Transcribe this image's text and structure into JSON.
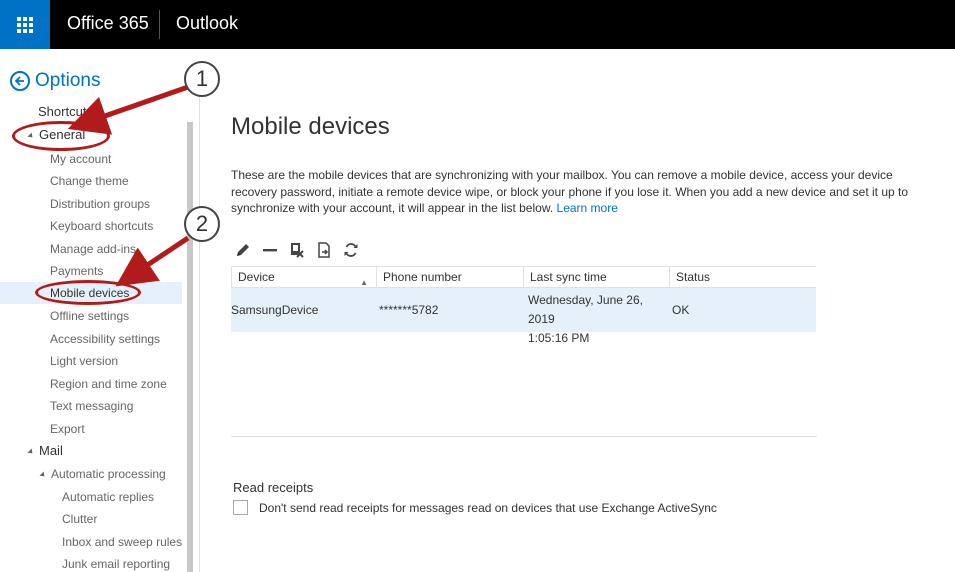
{
  "topbar": {
    "suite_name": "Office 365",
    "app_name": "Outlook",
    "accent_color": "#0072c6"
  },
  "nav": {
    "title": "Options",
    "items": [
      {
        "label": "Shortcuts",
        "type": "header"
      },
      {
        "label": "General",
        "type": "section"
      },
      {
        "label": "My account"
      },
      {
        "label": "Change theme"
      },
      {
        "label": "Distribution groups"
      },
      {
        "label": "Keyboard shortcuts"
      },
      {
        "label": "Manage add-ins"
      },
      {
        "label": "Payments"
      },
      {
        "label": "Mobile devices",
        "selected": true
      },
      {
        "label": "Offline settings"
      },
      {
        "label": "Accessibility settings"
      },
      {
        "label": "Light version"
      },
      {
        "label": "Region and time zone"
      },
      {
        "label": "Text messaging"
      },
      {
        "label": "Export"
      },
      {
        "label": "Mail",
        "type": "section"
      },
      {
        "label": "Automatic processing",
        "type": "subsection"
      },
      {
        "label": "Automatic replies"
      },
      {
        "label": "Clutter"
      },
      {
        "label": "Inbox and sweep rules"
      },
      {
        "label": "Junk email reporting"
      }
    ]
  },
  "main": {
    "title": "Mobile devices",
    "intro": "These are the mobile devices that are synchronizing with your mailbox. You can remove a mobile device, access your device recovery password, initiate a remote device wipe, or block your phone if you lose it. When you add a new device and set it up to synchronize with your account, it will appear in the list below.",
    "learn_more": "Learn more",
    "toolbar": [
      "edit-icon",
      "remove-icon",
      "wipe-icon",
      "block-icon",
      "refresh-icon"
    ],
    "columns": [
      "Device",
      "Phone number",
      "Last sync time",
      "Status"
    ],
    "rows": [
      {
        "device": "SamsungDevice",
        "phone": "*******5782",
        "sync_line1": "Wednesday, June 26, 2019",
        "sync_line2": "1:05:16 PM",
        "status": "OK"
      }
    ],
    "read_receipts": {
      "title": "Read receipts",
      "checkbox_label": "Don't send read receipts for messages read on devices that use Exchange ActiveSync",
      "checked": false
    }
  },
  "annotations": {
    "badge_1": "1",
    "badge_2": "2",
    "annotation_color": "#b11b1b"
  }
}
